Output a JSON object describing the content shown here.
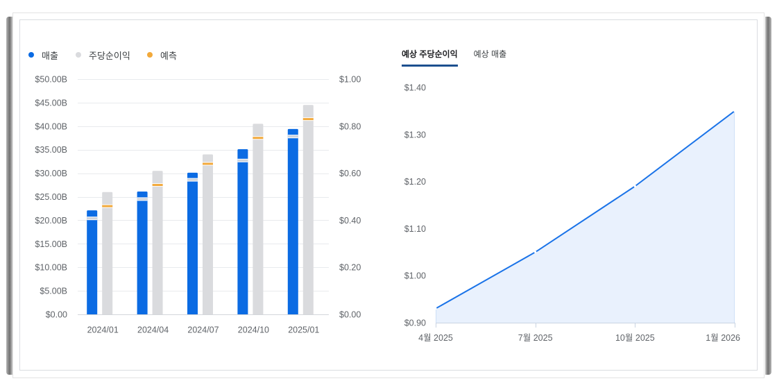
{
  "forecast_tabs": [
    {
      "label": "예상 주당순이익",
      "active": true
    },
    {
      "label": "예상 매출",
      "active": false
    }
  ],
  "chart_data": [
    {
      "type": "bar",
      "legend_position": "top-left",
      "categories": [
        "2024/01",
        "2024/04",
        "2024/07",
        "2024/10",
        "2025/01"
      ],
      "series": [
        {
          "name": "매출",
          "axis": "left",
          "color": "#0b6be3",
          "values": [
            22.1,
            26.1,
            30.1,
            35.1,
            39.4
          ],
          "estimates": [
            20.4,
            24.5,
            28.6,
            32.7,
            37.8
          ],
          "estimate_color": "#cdd3dc"
        },
        {
          "name": "주당순이익",
          "axis": "right",
          "color": "#dadbde",
          "values": [
            0.52,
            0.61,
            0.68,
            0.81,
            0.89
          ],
          "estimates": [
            0.46,
            0.55,
            0.64,
            0.75,
            0.83
          ],
          "estimate_color": "#f2a93b"
        }
      ],
      "estimate_legend": {
        "label": "예측",
        "color": "#f2a93b"
      },
      "y_left": {
        "min": 0,
        "max": 50,
        "tick_labels": [
          "$0.00",
          "$5.00B",
          "$10.00B",
          "$15.00B",
          "$20.00B",
          "$25.00B",
          "$30.00B",
          "$35.00B",
          "$40.00B",
          "$45.00B",
          "$50.00B"
        ]
      },
      "y_right": {
        "min": 0,
        "max": 1,
        "tick_labels": [
          "$0.00",
          "$0.20",
          "$0.40",
          "$0.60",
          "$0.80",
          "$1.00"
        ]
      },
      "grid": true
    },
    {
      "type": "area",
      "x": [
        "4월 2025",
        "7월 2025",
        "10월 2025",
        "1월 2026"
      ],
      "values": [
        0.93,
        1.05,
        1.19,
        1.35
      ],
      "ylim": [
        0.9,
        1.4
      ],
      "y_tick_labels": [
        "$0.90",
        "$1.00",
        "$1.10",
        "$1.20",
        "$1.30",
        "$1.40"
      ],
      "color": "#1a73e8",
      "fill": "#e9f1fd",
      "grid": false
    }
  ]
}
